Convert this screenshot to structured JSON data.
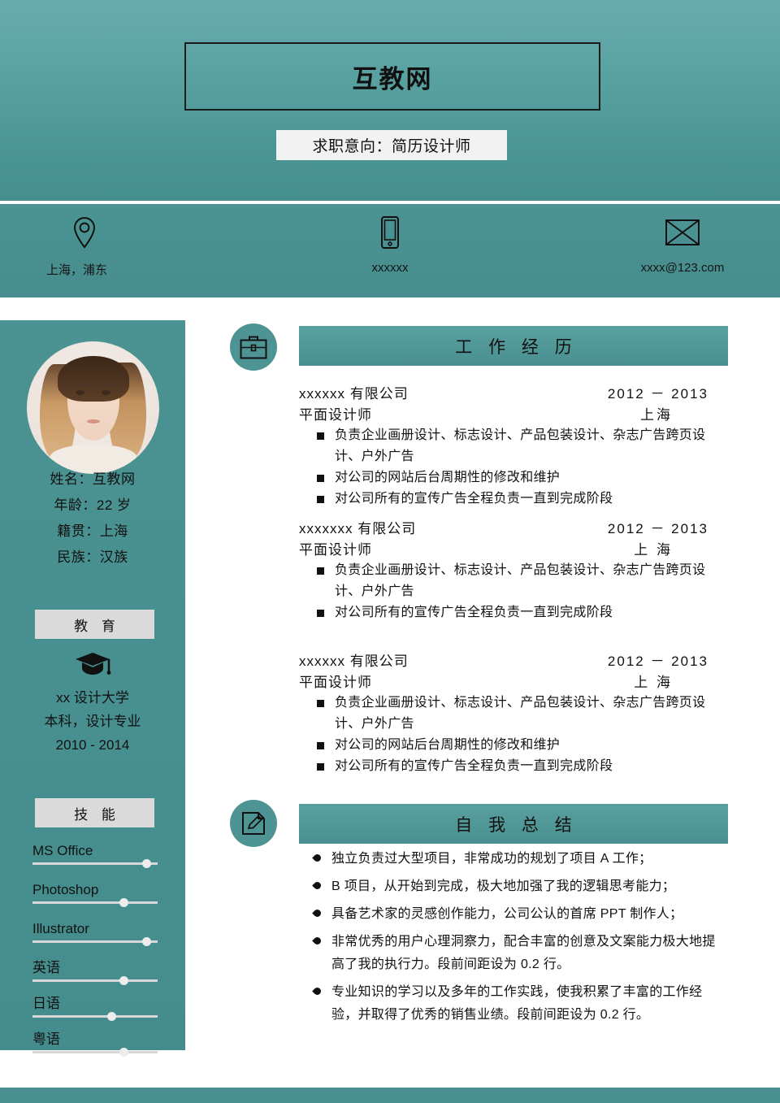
{
  "theme": {
    "teal_light": "#69abab",
    "teal_mid": "#4c9393",
    "teal_dark": "#468f8f",
    "panel_gray": "#dadada",
    "text_dark": "#111111"
  },
  "header": {
    "title": "互教网",
    "objective": "求职意向：简历设计师"
  },
  "contact": [
    {
      "icon": "location-pin-icon",
      "value": "上海，浦东"
    },
    {
      "icon": "mobile-phone-icon",
      "value": "xxxxxx"
    },
    {
      "icon": "envelope-icon",
      "value": "xxxx@123.com"
    }
  ],
  "sidebar": {
    "avatar": "profile-photo",
    "info": [
      "姓名：互教网",
      "年龄：22 岁",
      "籍贯：上海",
      "民族：汉族"
    ],
    "education": {
      "heading": "教 育",
      "icon": "graduation-cap-icon",
      "lines": [
        "xx 设计大学",
        "本科，设计专业",
        "2010 - 2014"
      ]
    },
    "skills": {
      "heading": "技 能",
      "items": [
        {
          "label": "MS Office",
          "level": 91
        },
        {
          "label": "Photoshop",
          "level": 73
        },
        {
          "label": "Illustrator",
          "level": 91
        },
        {
          "label": "英语",
          "level": 73
        },
        {
          "label": "日语",
          "level": 63
        },
        {
          "label": "粤语",
          "level": 73
        }
      ]
    }
  },
  "work": {
    "icon": "briefcase-icon",
    "heading": "工 作 经 历",
    "jobs": [
      {
        "company": "xxxxxx 有限公司",
        "period": "2012 － 2013",
        "role": "平面设计师",
        "location": "上海",
        "bullets": [
          "负责企业画册设计、标志设计、产品包装设计、杂志广告跨页设计、户外广告",
          "对公司的网站后台周期性的修改和维护",
          "对公司所有的宣传广告全程负责一直到完成阶段"
        ]
      },
      {
        "company": "xxxxxxx 有限公司",
        "period": "2012 － 2013",
        "role": "平面设计师",
        "location": "上 海",
        "bullets": [
          "负责企业画册设计、标志设计、产品包装设计、杂志广告跨页设计、户外广告",
          "对公司所有的宣传广告全程负责一直到完成阶段"
        ]
      },
      {
        "company": "xxxxxx 有限公司",
        "period": "2012 － 2013",
        "role": "平面设计师",
        "location": "上 海",
        "bullets": [
          "负责企业画册设计、标志设计、产品包装设计、杂志广告跨页设计、户外广告",
          "对公司的网站后台周期性的修改和维护",
          "对公司所有的宣传广告全程负责一直到完成阶段"
        ]
      }
    ]
  },
  "summary": {
    "icon": "pencil-note-icon",
    "heading": "自 我 总 结",
    "items": [
      "独立负责过大型项目，非常成功的规划了项目 A 工作；",
      "B 项目，从开始到完成，极大地加强了我的逻辑思考能力；",
      "具备艺术家的灵感创作能力，公司公认的首席 PPT 制作人；",
      "非常优秀的用户心理洞察力，配合丰富的创意及文案能力极大地提高了我的执行力。段前间距设为 0.2 行。",
      "专业知识的学习以及多年的工作实践，使我积累了丰富的工作经验，并取得了优秀的销售业绩。段前间距设为 0.2 行。"
    ]
  }
}
